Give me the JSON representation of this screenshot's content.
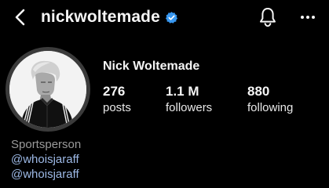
{
  "header": {
    "username": "nickwoltemade",
    "back_icon": "chevron-left-icon",
    "verified_icon": "verified-badge-icon",
    "verified_color": "#3897f0",
    "notifications_icon": "bell-icon",
    "more_icon": "more-horizontal-icon"
  },
  "profile": {
    "display_name": "Nick Woltemade",
    "avatar": "profile-photo",
    "stats": [
      {
        "value": "276",
        "label": "posts"
      },
      {
        "value": "1.1 M",
        "label": "followers"
      },
      {
        "value": "880",
        "label": "following"
      }
    ]
  },
  "bio": {
    "category": "Sportsperson",
    "mentions": [
      "@whoisjaraff",
      "@whoisjaraff"
    ],
    "link_color": "#9db9e6"
  }
}
